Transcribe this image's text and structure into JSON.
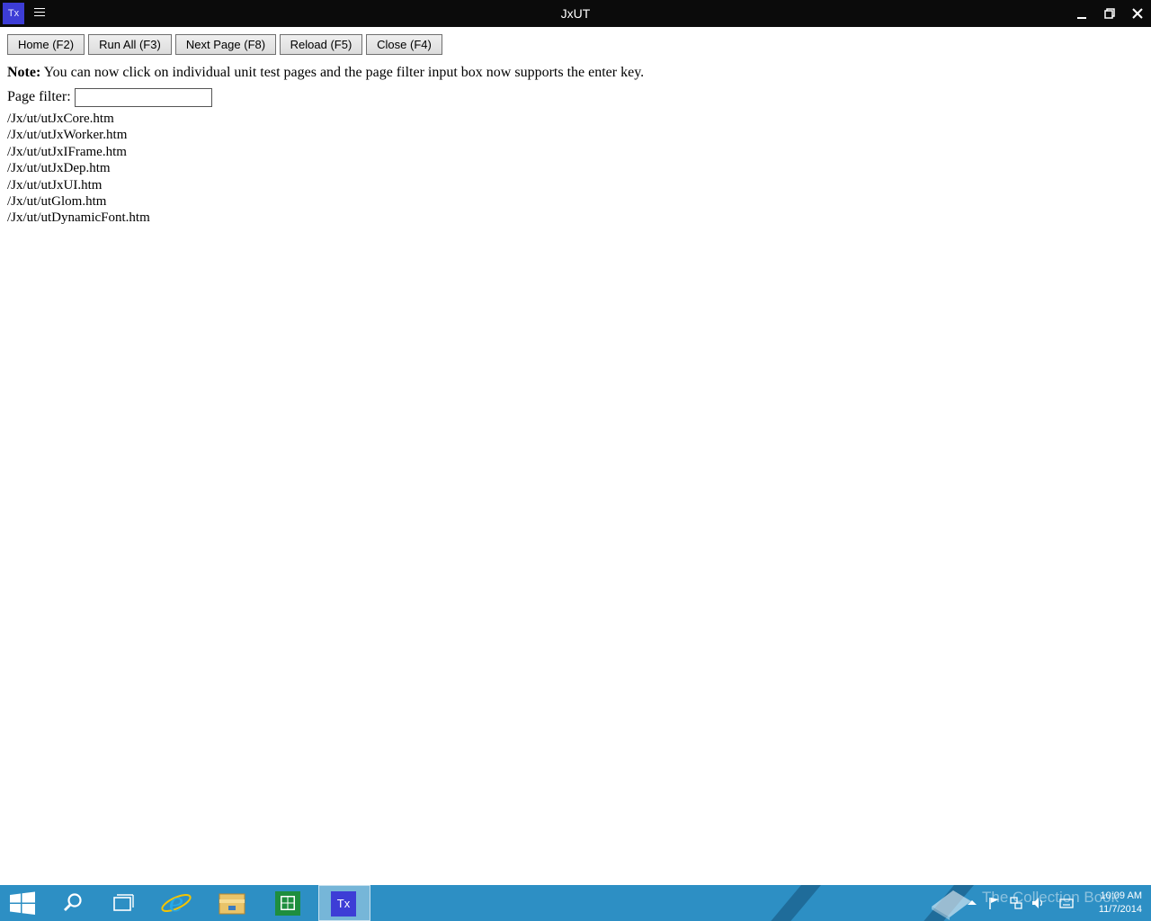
{
  "window": {
    "title": "JxUT",
    "app_icon_label": "Tx"
  },
  "toolbar": {
    "home_label": "Home (F2)",
    "run_all_label": "Run All (F3)",
    "next_page_label": "Next Page (F8)",
    "reload_label": "Reload (F5)",
    "close_label": "Close (F4)"
  },
  "note": {
    "label": "Note:",
    "text": " You can now click on individual unit test pages and the page filter input box now supports the enter key."
  },
  "filter": {
    "label": "Page filter:",
    "value": ""
  },
  "pages": [
    "/Jx/ut/utJxCore.htm",
    "/Jx/ut/utJxWorker.htm",
    "/Jx/ut/utJxIFrame.htm",
    "/Jx/ut/utJxDep.htm",
    "/Jx/ut/utJxUI.htm",
    "/Jx/ut/utGlom.htm",
    "/Jx/ut/utDynamicFont.htm"
  ],
  "taskbar": {
    "items": [
      "start-icon",
      "search-icon",
      "task-view-icon",
      "internet-explorer-icon",
      "file-explorer-icon",
      "store-icon",
      "tx-app-icon"
    ],
    "active_app_label": "Tx",
    "watermark": "The Collection Book",
    "clock_time": "10:09 AM",
    "clock_date": "11/7/2014",
    "accent_color": "#2d8fc4"
  }
}
